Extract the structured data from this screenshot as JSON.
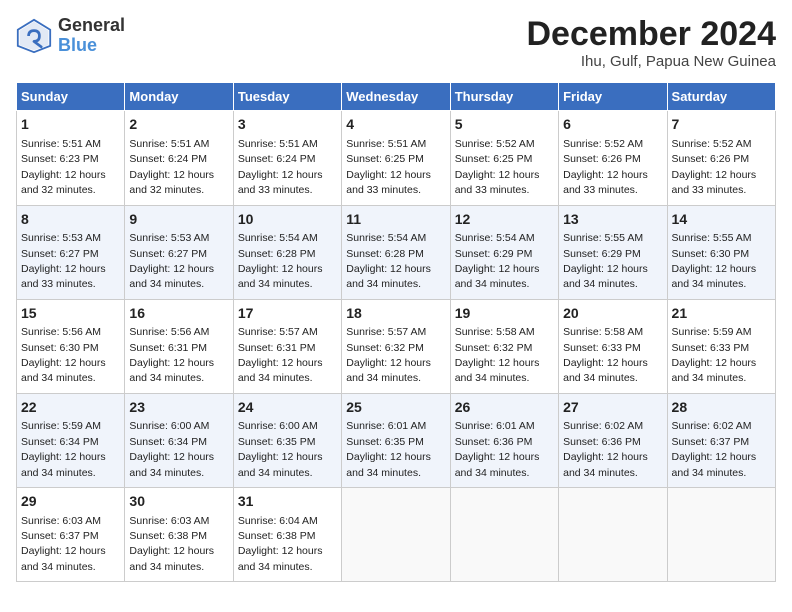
{
  "header": {
    "logo_line1": "General",
    "logo_line2": "Blue",
    "title": "December 2024",
    "subtitle": "Ihu, Gulf, Papua New Guinea"
  },
  "days_of_week": [
    "Sunday",
    "Monday",
    "Tuesday",
    "Wednesday",
    "Thursday",
    "Friday",
    "Saturday"
  ],
  "weeks": [
    [
      {
        "day": "1",
        "sunrise": "5:51 AM",
        "sunset": "6:23 PM",
        "daylight": "12 hours and 32 minutes."
      },
      {
        "day": "2",
        "sunrise": "5:51 AM",
        "sunset": "6:24 PM",
        "daylight": "12 hours and 32 minutes."
      },
      {
        "day": "3",
        "sunrise": "5:51 AM",
        "sunset": "6:24 PM",
        "daylight": "12 hours and 33 minutes."
      },
      {
        "day": "4",
        "sunrise": "5:51 AM",
        "sunset": "6:25 PM",
        "daylight": "12 hours and 33 minutes."
      },
      {
        "day": "5",
        "sunrise": "5:52 AM",
        "sunset": "6:25 PM",
        "daylight": "12 hours and 33 minutes."
      },
      {
        "day": "6",
        "sunrise": "5:52 AM",
        "sunset": "6:26 PM",
        "daylight": "12 hours and 33 minutes."
      },
      {
        "day": "7",
        "sunrise": "5:52 AM",
        "sunset": "6:26 PM",
        "daylight": "12 hours and 33 minutes."
      }
    ],
    [
      {
        "day": "8",
        "sunrise": "5:53 AM",
        "sunset": "6:27 PM",
        "daylight": "12 hours and 33 minutes."
      },
      {
        "day": "9",
        "sunrise": "5:53 AM",
        "sunset": "6:27 PM",
        "daylight": "12 hours and 34 minutes."
      },
      {
        "day": "10",
        "sunrise": "5:54 AM",
        "sunset": "6:28 PM",
        "daylight": "12 hours and 34 minutes."
      },
      {
        "day": "11",
        "sunrise": "5:54 AM",
        "sunset": "6:28 PM",
        "daylight": "12 hours and 34 minutes."
      },
      {
        "day": "12",
        "sunrise": "5:54 AM",
        "sunset": "6:29 PM",
        "daylight": "12 hours and 34 minutes."
      },
      {
        "day": "13",
        "sunrise": "5:55 AM",
        "sunset": "6:29 PM",
        "daylight": "12 hours and 34 minutes."
      },
      {
        "day": "14",
        "sunrise": "5:55 AM",
        "sunset": "6:30 PM",
        "daylight": "12 hours and 34 minutes."
      }
    ],
    [
      {
        "day": "15",
        "sunrise": "5:56 AM",
        "sunset": "6:30 PM",
        "daylight": "12 hours and 34 minutes."
      },
      {
        "day": "16",
        "sunrise": "5:56 AM",
        "sunset": "6:31 PM",
        "daylight": "12 hours and 34 minutes."
      },
      {
        "day": "17",
        "sunrise": "5:57 AM",
        "sunset": "6:31 PM",
        "daylight": "12 hours and 34 minutes."
      },
      {
        "day": "18",
        "sunrise": "5:57 AM",
        "sunset": "6:32 PM",
        "daylight": "12 hours and 34 minutes."
      },
      {
        "day": "19",
        "sunrise": "5:58 AM",
        "sunset": "6:32 PM",
        "daylight": "12 hours and 34 minutes."
      },
      {
        "day": "20",
        "sunrise": "5:58 AM",
        "sunset": "6:33 PM",
        "daylight": "12 hours and 34 minutes."
      },
      {
        "day": "21",
        "sunrise": "5:59 AM",
        "sunset": "6:33 PM",
        "daylight": "12 hours and 34 minutes."
      }
    ],
    [
      {
        "day": "22",
        "sunrise": "5:59 AM",
        "sunset": "6:34 PM",
        "daylight": "12 hours and 34 minutes."
      },
      {
        "day": "23",
        "sunrise": "6:00 AM",
        "sunset": "6:34 PM",
        "daylight": "12 hours and 34 minutes."
      },
      {
        "day": "24",
        "sunrise": "6:00 AM",
        "sunset": "6:35 PM",
        "daylight": "12 hours and 34 minutes."
      },
      {
        "day": "25",
        "sunrise": "6:01 AM",
        "sunset": "6:35 PM",
        "daylight": "12 hours and 34 minutes."
      },
      {
        "day": "26",
        "sunrise": "6:01 AM",
        "sunset": "6:36 PM",
        "daylight": "12 hours and 34 minutes."
      },
      {
        "day": "27",
        "sunrise": "6:02 AM",
        "sunset": "6:36 PM",
        "daylight": "12 hours and 34 minutes."
      },
      {
        "day": "28",
        "sunrise": "6:02 AM",
        "sunset": "6:37 PM",
        "daylight": "12 hours and 34 minutes."
      }
    ],
    [
      {
        "day": "29",
        "sunrise": "6:03 AM",
        "sunset": "6:37 PM",
        "daylight": "12 hours and 34 minutes."
      },
      {
        "day": "30",
        "sunrise": "6:03 AM",
        "sunset": "6:38 PM",
        "daylight": "12 hours and 34 minutes."
      },
      {
        "day": "31",
        "sunrise": "6:04 AM",
        "sunset": "6:38 PM",
        "daylight": "12 hours and 34 minutes."
      },
      null,
      null,
      null,
      null
    ]
  ]
}
